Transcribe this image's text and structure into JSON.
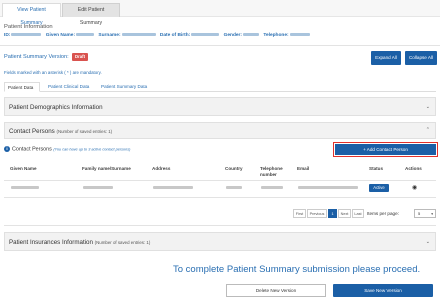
{
  "tabs": {
    "view": "View Patient Summary",
    "edit": "Edit Patient Summary"
  },
  "patient_info": {
    "title": "Patient Information",
    "id_label": "ID:",
    "given_label": "Given Name:",
    "surname_label": "Surname:",
    "dob_label": "Date of Birth:",
    "gender_label": "Gender:",
    "telephone_label": "Telephone:"
  },
  "summary": {
    "version_label": "Patient Summary Version:",
    "draft": "Draft",
    "expand_all": "Expand All",
    "collapse_all": "Collapse All",
    "mandatory_note": "Fields marked with an asterisk ( * ) are mandatory."
  },
  "subtabs": [
    "Patient Data",
    "Patient Clinical Data",
    "Patient Summary Data"
  ],
  "sections": {
    "demographics": "Patient Demographics Information",
    "contact_persons": "Contact Persons",
    "contact_count": "(Number of saved entries: 1)",
    "insurances": "Patient Insurances Information",
    "insurances_count": "(Number of saved entries: 1)"
  },
  "contact": {
    "heading": "Contact Persons",
    "note": "(You can have up to 3 active contact persons)",
    "add_button": "+ Add Contact Person",
    "columns": [
      "Given Name",
      "Family name/Surname",
      "Address",
      "Country",
      "Telephone number",
      "Email",
      "Status",
      "Actions"
    ],
    "row": {
      "status": "Active"
    }
  },
  "pagination": {
    "first": "First",
    "previous": "Previous",
    "current": "1",
    "next": "Next",
    "last": "Last",
    "items_per_page_label": "Items per page:",
    "items_per_page_value": "5"
  },
  "footer": {
    "message": "To complete Patient Summary submission please proceed.",
    "delete": "Delete New Version",
    "save": "Save New Version"
  },
  "colors": {
    "primary": "#1b5fa6",
    "link": "#2a6fb2",
    "draft": "#d9534f",
    "highlight_border": "#e0312b"
  },
  "icons": {
    "info": "info-icon",
    "expand_chevron": "chevron-down-icon",
    "collapse_chevron": "chevron-up-icon",
    "view_action": "eye-icon"
  }
}
